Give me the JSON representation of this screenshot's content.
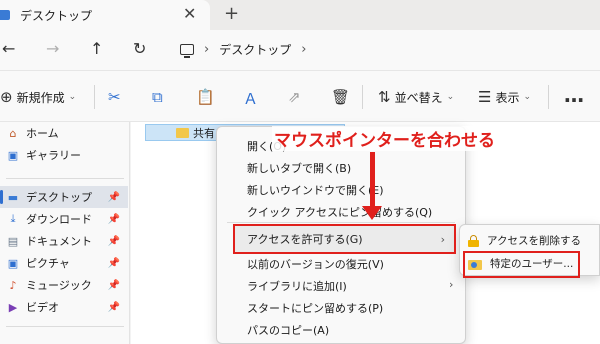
{
  "tab": {
    "title": "デスクトップ",
    "close_glyph": "✕",
    "new_glyph": "+"
  },
  "navbar": {
    "back_glyph": "←",
    "forward_glyph": "→",
    "up_glyph": "↑",
    "refresh_glyph": "↻",
    "separator_glyph": "›",
    "crumb": "デスクトップ"
  },
  "toolbar": {
    "new_glyph": "⊕",
    "new_label": "新規作成",
    "cut_glyph": "✂",
    "copy_glyph": "⧉",
    "paste_glyph": "📋",
    "rename_glyph": "Ａ",
    "share_glyph": "⇗",
    "delete_glyph": "🗑",
    "sort_glyph": "⇅",
    "sort_label": "並べ替え",
    "view_glyph": "☰",
    "view_label": "表示",
    "more_glyph": "…",
    "chevron_glyph": "⌄"
  },
  "sidebar": {
    "pin_glyph": "📌",
    "home": {
      "icon": "⌂",
      "label": "ホーム"
    },
    "gallery": {
      "icon": "▣",
      "label": "ギャラリー"
    },
    "desktop": {
      "icon": "▬",
      "label": "デスクトップ"
    },
    "downloads": {
      "icon": "⤓",
      "label": "ダウンロード"
    },
    "documents": {
      "icon": "▤",
      "label": "ドキュメント"
    },
    "pictures": {
      "icon": "▣",
      "label": "ピクチャ"
    },
    "music": {
      "icon": "♪",
      "label": "ミュージック"
    },
    "videos": {
      "icon": "▶",
      "label": "ビデオ"
    }
  },
  "file": {
    "name": "共有フォルダ"
  },
  "context_menu": {
    "open": "開く(O)",
    "open_new_tab": "新しいタブで開く(B)",
    "open_new_window": "新しいウインドウで開く(E)",
    "pin_quick_access": "クイック アクセスにピン留めする(Q)",
    "give_access": "アクセスを許可する(G)",
    "restore_previous": "以前のバージョンの復元(V)",
    "include_library": "ライブラリに追加(I)",
    "pin_start": "スタートにピン留めする(P)",
    "copy_path": "パスのコピー(A)",
    "arrow_glyph": "›"
  },
  "submenu": {
    "remove_access": "アクセスを削除する",
    "specific_users": "特定のユーザー..."
  },
  "annotation": {
    "text": "マウスポインターを合わせる"
  },
  "colors": {
    "accent": "#2f6fd0",
    "highlight_red": "#e0201c",
    "menu_hover": "#ebebeb"
  }
}
